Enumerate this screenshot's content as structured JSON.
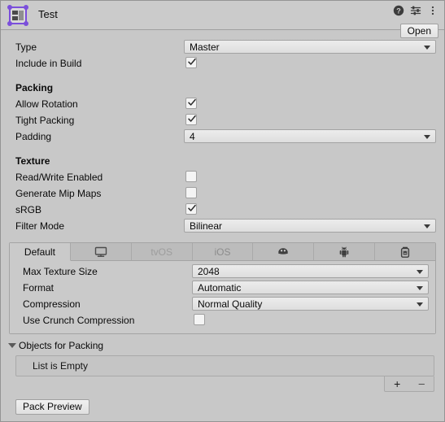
{
  "window": {
    "title": "Test",
    "asset_icon": "sprite-atlas-icon",
    "open_label": "Open",
    "header_icons": [
      "help-icon",
      "preset-icon",
      "more-menu-icon"
    ]
  },
  "properties": [
    {
      "label": "Type",
      "control": "dropdown",
      "value": "Master"
    },
    {
      "label": "Include in Build",
      "control": "checkbox",
      "checked": true
    }
  ],
  "packing": {
    "header": "Packing",
    "rows": [
      {
        "label": "Allow Rotation",
        "control": "checkbox",
        "checked": true
      },
      {
        "label": "Tight Packing",
        "control": "checkbox",
        "checked": true
      },
      {
        "label": "Padding",
        "control": "dropdown",
        "value": "4"
      }
    ]
  },
  "texture": {
    "header": "Texture",
    "rows": [
      {
        "label": "Read/Write Enabled",
        "control": "checkbox",
        "checked": false
      },
      {
        "label": "Generate Mip Maps",
        "control": "checkbox",
        "checked": false
      },
      {
        "label": "sRGB",
        "control": "checkbox",
        "checked": true
      },
      {
        "label": "Filter Mode",
        "control": "dropdown",
        "value": "Bilinear"
      }
    ]
  },
  "platform_tabs": [
    {
      "label": "Default",
      "icon": "",
      "selected": true,
      "state": "active"
    },
    {
      "label": "",
      "icon": "standalone-monitor-icon",
      "selected": false,
      "state": "normal"
    },
    {
      "label": "tvOS",
      "icon": "",
      "selected": false,
      "state": "disabled"
    },
    {
      "label": "iOS",
      "icon": "",
      "selected": false,
      "state": "dim"
    },
    {
      "label": "",
      "icon": "webgl-icon",
      "selected": false,
      "state": "normal"
    },
    {
      "label": "",
      "icon": "android-icon",
      "selected": false,
      "state": "normal"
    },
    {
      "label": "",
      "icon": "uwp-icon",
      "selected": false,
      "state": "normal"
    }
  ],
  "platform_settings": [
    {
      "label": "Max Texture Size",
      "control": "dropdown",
      "value": "2048"
    },
    {
      "label": "Format",
      "control": "dropdown",
      "value": "Automatic"
    },
    {
      "label": "Compression",
      "control": "dropdown",
      "value": "Normal Quality"
    },
    {
      "label": "Use Crunch Compression",
      "control": "checkbox",
      "checked": false
    }
  ],
  "objects_for_packing": {
    "title": "Objects for Packing",
    "expanded": true,
    "empty_text": "List is Empty",
    "add_label": "+",
    "remove_label": "–"
  },
  "footer": {
    "pack_preview_label": "Pack Preview"
  },
  "colors": {
    "panel_bg": "#c8c8c8",
    "header_bg": "#cbcbcb",
    "field_bg": "#e6e6e6",
    "border": "#a0a0a0",
    "accent_purple": "#7b4fdb",
    "text": "#090909",
    "disabled_text": "#9d9d9d"
  }
}
